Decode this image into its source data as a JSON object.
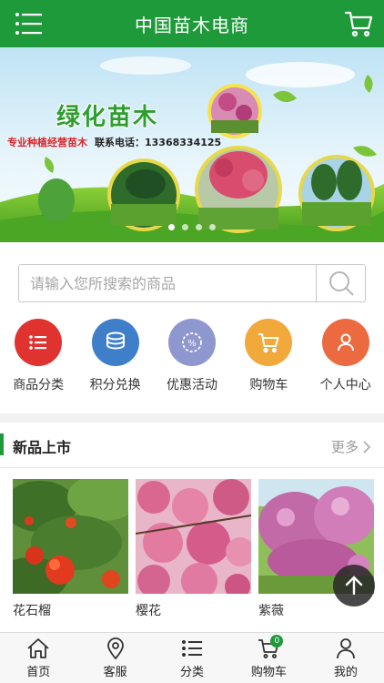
{
  "header": {
    "title": "中国苗木电商"
  },
  "banner": {
    "headline": "绿化苗木",
    "tagline": "专业种植经营苗木",
    "phone": "联系电话：13368334125",
    "slides": 4,
    "active_slide": 1
  },
  "search": {
    "placeholder": "请输入您所搜索的商品"
  },
  "quick_nav": [
    {
      "label": "商品分类",
      "icon": "list-icon",
      "color": "#e0322f"
    },
    {
      "label": "积分兑换",
      "icon": "coins-icon",
      "color": "#3f7fc9"
    },
    {
      "label": "优惠活动",
      "icon": "discount-icon",
      "color": "#8f97cf"
    },
    {
      "label": "购物车",
      "icon": "cart-icon",
      "color": "#f2a93b"
    },
    {
      "label": "个人中心",
      "icon": "user-icon",
      "color": "#ec6a3f"
    }
  ],
  "new_products": {
    "title": "新品上市",
    "more": "更多",
    "items": [
      {
        "name": "花石榴"
      },
      {
        "name": "樱花"
      },
      {
        "name": "紫薇"
      }
    ]
  },
  "tabbar": {
    "items": [
      {
        "label": "首页",
        "icon": "home-icon"
      },
      {
        "label": "客服",
        "icon": "location-icon"
      },
      {
        "label": "分类",
        "icon": "list-icon"
      },
      {
        "label": "购物车",
        "icon": "cart-icon",
        "badge": "0"
      },
      {
        "label": "我的",
        "icon": "user-icon"
      }
    ]
  },
  "colors": {
    "brand_green": "#1f9a3a"
  }
}
